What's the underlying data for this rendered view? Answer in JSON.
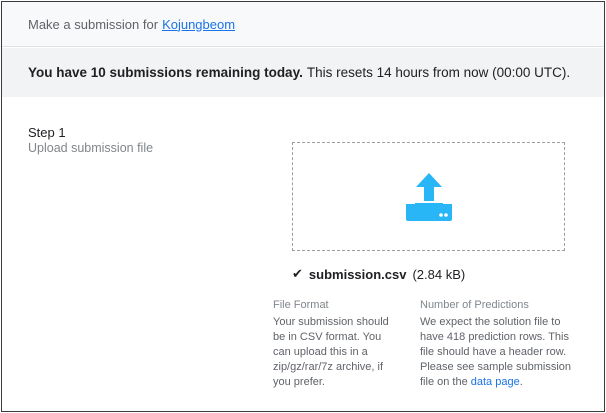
{
  "header": {
    "prefix": "Make a submission for",
    "username": "Kojungbeom"
  },
  "notice": {
    "bold": "You have 10 submissions remaining today.",
    "rest": "This resets 14 hours from now (00:00 UTC)."
  },
  "step": {
    "title": "Step 1",
    "subtitle": "Upload submission file"
  },
  "dropzone": {
    "icon": "upload-icon",
    "color": "#29b6f6"
  },
  "file": {
    "check_icon": "✔",
    "name": "submission.csv",
    "size": "(2.84 kB)"
  },
  "file_format": {
    "title": "File Format",
    "body": "Your submission should be in CSV format. You can upload this in a zip/gz/rar/7z archive, if you prefer."
  },
  "predictions": {
    "title": "Number of Predictions",
    "body": "We expect the solution file to have 418 prediction rows. This file should have a header row. Please see sample submission file on the",
    "link": "data page",
    "end": "."
  }
}
